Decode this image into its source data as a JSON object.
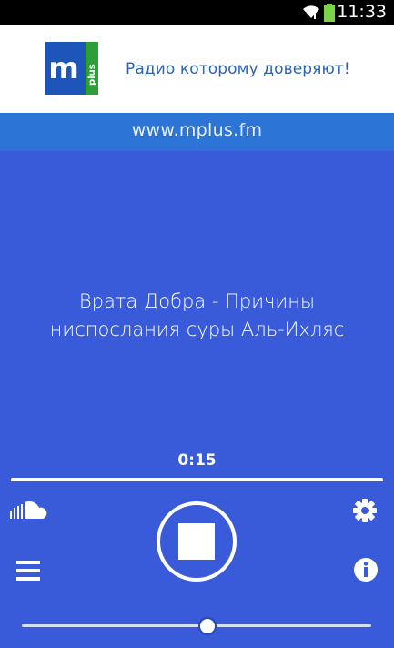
{
  "status_bar": {
    "time": "11:33",
    "wifi_icon": "wifi-icon",
    "battery_icon": "battery-icon"
  },
  "header": {
    "logo": {
      "letter": "m",
      "side_text": "plus",
      "brand_color": "#1d56b8",
      "accent_color": "#2e9e3a"
    },
    "tagline": "Радио которому доверяют!"
  },
  "url_bar": {
    "text": "www.mplus.fm"
  },
  "player": {
    "track_title_line1": "Врата Добра - Причины",
    "track_title_line2": "ниспослания суры Аль-Ихляс",
    "elapsed": "0:15",
    "progress_percent": 100,
    "volume_percent": 53,
    "icons": {
      "soundcloud": "soundcloud-icon",
      "settings": "gear-icon",
      "stop": "stop-icon",
      "menu": "menu-icon",
      "info": "info-icon"
    }
  },
  "colors": {
    "background": "#3a5bd9",
    "url_bar": "#2c74d6",
    "tagline": "#2b63b5",
    "status_bar": "#000000"
  }
}
